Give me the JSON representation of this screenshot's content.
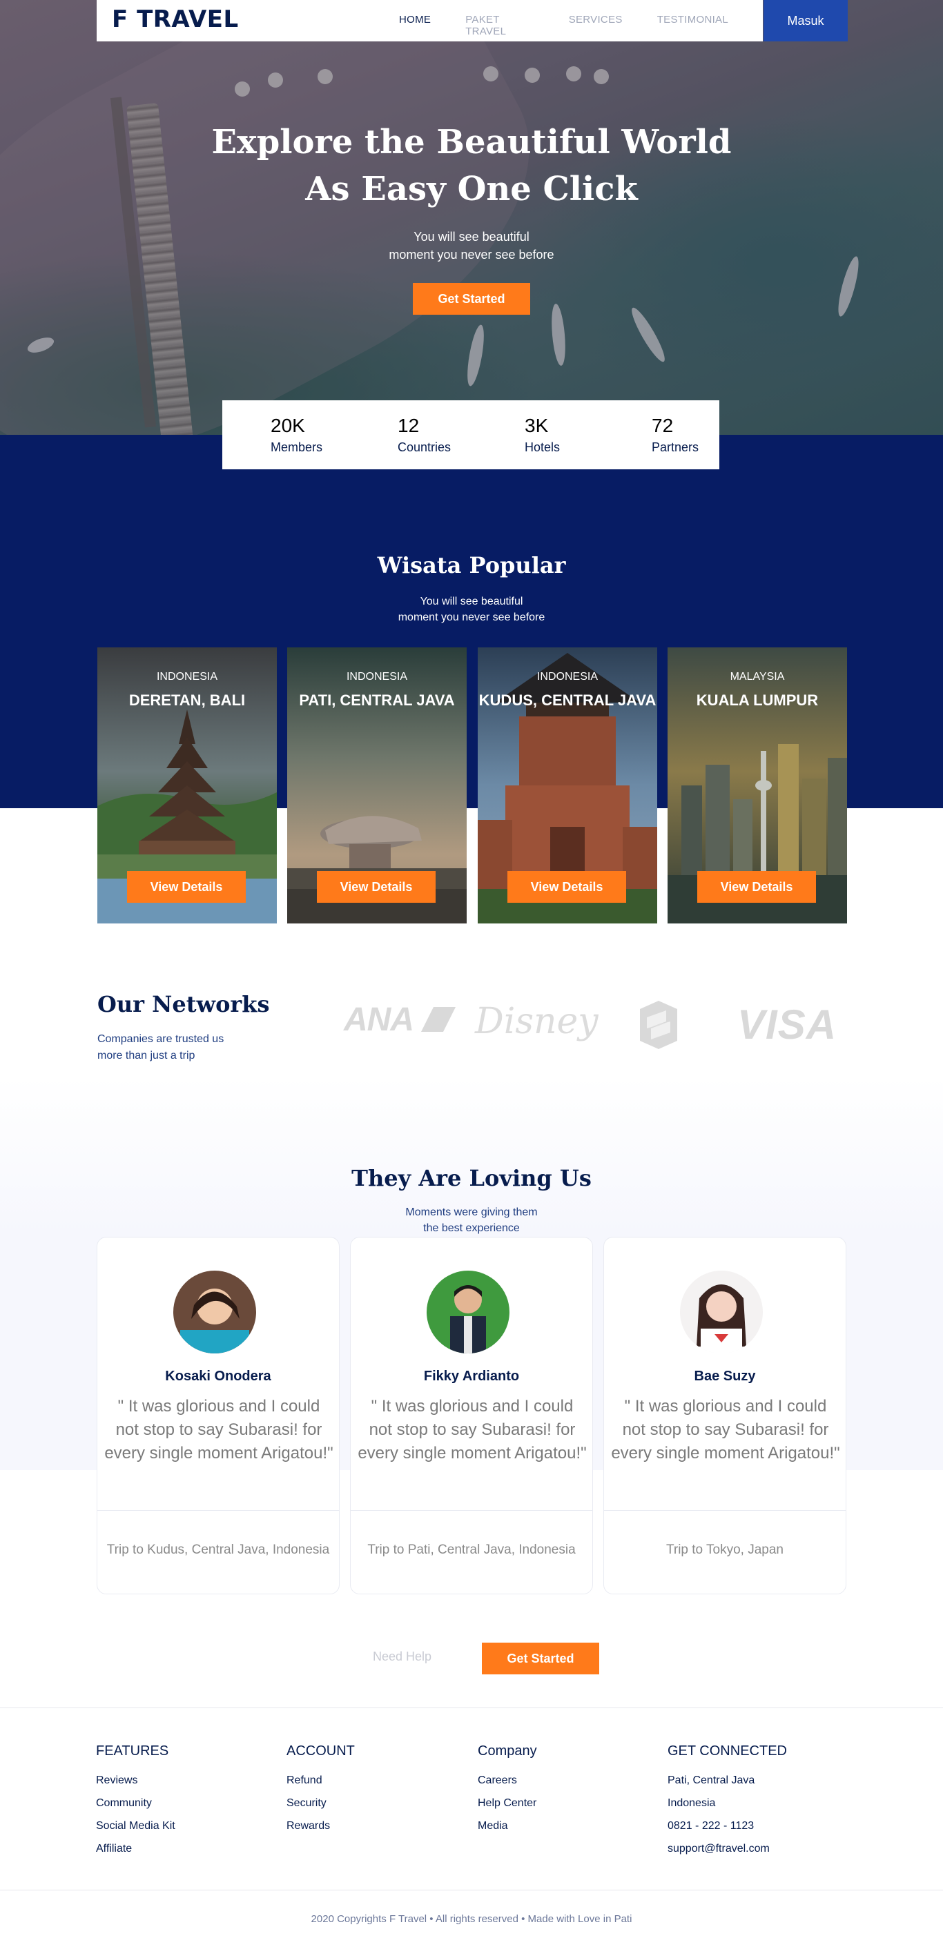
{
  "nav": {
    "logo": "F TRAVEL",
    "links": [
      "HOME",
      "PAKET TRAVEL",
      "SERVICES",
      "TESTIMONIAL"
    ],
    "login": "Masuk"
  },
  "hero": {
    "title_line1": "Explore the Beautiful World",
    "title_line2": "As Easy One Click",
    "sub_line1": "You will see beautiful",
    "sub_line2": "moment you never see before",
    "cta": "Get Started"
  },
  "stats": [
    {
      "value": "20K",
      "label": "Members"
    },
    {
      "value": "12",
      "label": "Countries"
    },
    {
      "value": "3K",
      "label": "Hotels"
    },
    {
      "value": "72",
      "label": "Partners"
    }
  ],
  "popular": {
    "title": "Wisata Popular",
    "sub_line1": "You will see beautiful",
    "sub_line2": "moment you never see before",
    "cards": [
      {
        "country": "INDONESIA",
        "city": "DERETAN, BALI",
        "button": "View Details"
      },
      {
        "country": "INDONESIA",
        "city": "PATI, CENTRAL JAVA",
        "button": "View Details"
      },
      {
        "country": "INDONESIA",
        "city": "KUDUS, CENTRAL JAVA",
        "button": "View Details"
      },
      {
        "country": "MALAYSIA",
        "city": "KUALA LUMPUR",
        "button": "View Details"
      }
    ]
  },
  "networks": {
    "title": "Our Networks",
    "sub_line1": "Companies are trusted us",
    "sub_line2": "more than just a trip",
    "partners": [
      "ANA",
      "Disney",
      "VISA"
    ]
  },
  "testimonials": {
    "title": "They Are Loving Us",
    "sub_line1": "Moments were giving them",
    "sub_line2": "the best experience",
    "items": [
      {
        "name": "Kosaki Onodera",
        "quote": "\" It was glorious and I could not stop to say Subarasi! for every single moment Arigatou!\"",
        "trip": "Trip to Kudus, Central Java, Indonesia"
      },
      {
        "name": "Fikky Ardianto",
        "quote": "\" It was glorious and I could not stop to say Subarasi! for every single moment Arigatou!\"",
        "trip": "Trip to Pati, Central Java, Indonesia"
      },
      {
        "name": "Bae Suzy",
        "quote": "\" It was glorious and I could not stop to say Subarasi! for every single moment Arigatou!\"",
        "trip": "Trip to Tokyo, Japan"
      }
    ]
  },
  "cta_row": {
    "help": "Need Help",
    "cta": "Get Started"
  },
  "footer": {
    "columns": [
      {
        "title": "FEATURES",
        "items": [
          "Reviews",
          "Community",
          "Social Media Kit",
          "Affiliate"
        ]
      },
      {
        "title": "ACCOUNT",
        "items": [
          "Refund",
          "Security",
          "Rewards"
        ]
      },
      {
        "title": "Company",
        "items": [
          "Careers",
          "Help Center",
          "Media"
        ]
      },
      {
        "title": "GET CONNECTED",
        "items": [
          "Pati, Central Java",
          "Indonesia",
          "0821 - 222 - 1123",
          "support@ftravel.com"
        ]
      }
    ],
    "copyright": "2020 Copyrights F Travel • All rights reserved • Made with Love in Pati"
  },
  "colors": {
    "navy": "#071c4d",
    "section_blue": "#071c64",
    "login_blue": "#1f49ad",
    "orange": "#ff7a1a"
  }
}
